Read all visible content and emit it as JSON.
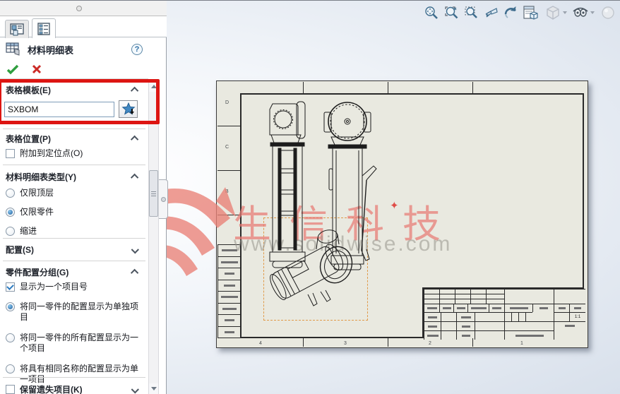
{
  "toolbar": {
    "icons": [
      {
        "name": "zoom-to-fit"
      },
      {
        "name": "zoom-to-area"
      },
      {
        "name": "zoom-to-selection"
      },
      {
        "name": "previous-view"
      },
      {
        "name": "rotate-view"
      },
      {
        "name": "3d-drawing-view"
      },
      {
        "name": "display-style",
        "disabled": true
      },
      {
        "name": "hide-show-items",
        "disabled": false
      },
      {
        "name": "appearance",
        "disabled": true
      }
    ]
  },
  "panel": {
    "title": "材料明细表",
    "sections": {
      "template": {
        "title": "表格模板(E)",
        "input_value": "SXBOM"
      },
      "position": {
        "title": "表格位置(P)",
        "option": "附加到定位点(O)",
        "checked": false
      },
      "bom_type": {
        "title": "材料明细表类型(Y)",
        "options": [
          "仅限顶层",
          "仅限零件",
          "缩进"
        ],
        "selected": "仅限零件"
      },
      "configurations": {
        "title": "配置(S)",
        "collapsed": true
      },
      "part_grouping": {
        "title": "零件配置分组(G)",
        "checkbox": "显示为一个项目号",
        "checkbox_checked": true,
        "options": [
          "将同一零件的配置显示为单独项目",
          "将同一零件的所有配置显示为一个项目",
          "将具有相同名称的配置显示为单一项目"
        ],
        "selected": "将同一零件的配置显示为单独项目"
      },
      "keep_missing": {
        "title": "保留遗失项目(K)",
        "checked": false
      }
    }
  },
  "watermark": {
    "brand": "生信科技",
    "spark": "✦",
    "url": "www.solidwise.com"
  },
  "sheet": {
    "scale": "1:1",
    "zone_numbers_bottom": [
      "4",
      "3",
      "2",
      "1"
    ],
    "zone_letters_left": [
      "D",
      "C",
      "B"
    ]
  }
}
